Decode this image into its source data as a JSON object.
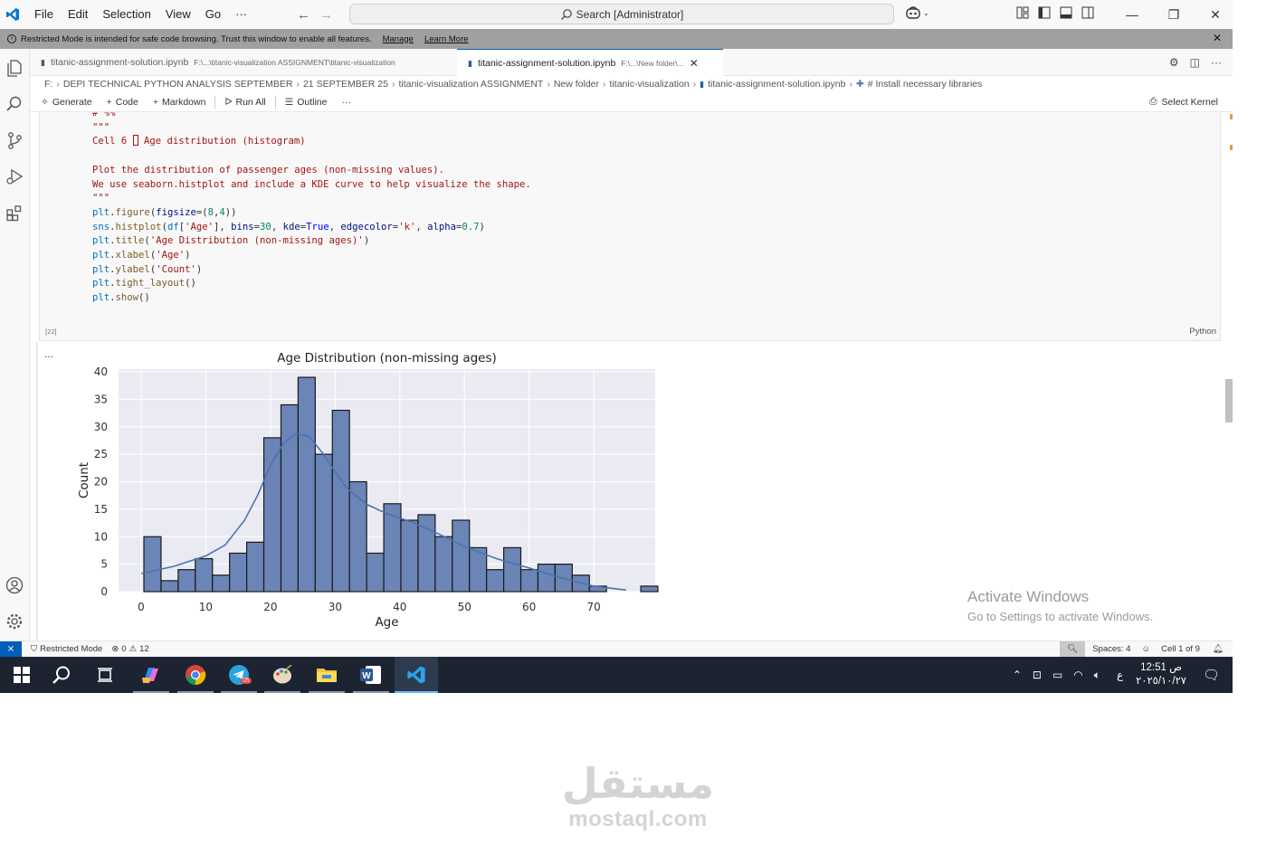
{
  "titlebar": {
    "menu": [
      "File",
      "Edit",
      "Selection",
      "View",
      "Go",
      "···"
    ],
    "search": "Search [Administrator]"
  },
  "banner": {
    "message": "Restricted Mode is intended for safe code browsing. Trust this window to enable all features.",
    "manage": "Manage",
    "learn_more": "Learn More"
  },
  "tabs": [
    {
      "name": "titanic-assignment-solution.ipynb",
      "path": "F:\\...\\titanic-visualization ASSIGNMENT\\titanic-visualization"
    },
    {
      "name": "titanic-assignment-solution.ipynb",
      "path": "F:\\...\\New folder\\..."
    }
  ],
  "breadcrumb": [
    "F:",
    "DEPI TECHNICAL PYTHON ANALYSIS SEPTEMBER",
    "21 SEPTEMBER 25",
    "titanic-visualization ASSIGNMENT",
    "New folder",
    "titanic-visualization",
    "titanic-assignment-solution.ipynb",
    "# Install necessary libraries"
  ],
  "toolbar": {
    "generate": "Generate",
    "code": "Code",
    "markdown": "Markdown",
    "run_all": "Run All",
    "outline": "Outline",
    "more": "···",
    "select_kernel": "Select Kernel"
  },
  "cell": {
    "exec_count": "[22]",
    "language": "Python",
    "output_dots": "...",
    "lines": {
      "l0": "# %%",
      "l1": "\"\"\"",
      "l2a": "Cell 6 ",
      "l2b": " Age distribution (histogram)",
      "l3": "",
      "l4": "Plot the distribution of passenger ages (non-missing values).",
      "l5": "We use seaborn.histplot and include a KDE curve to help visualize the shape.",
      "l6": "\"\"\"",
      "l7": "plt.figure(figsize=(8,4))",
      "l8": "sns.histplot(df['Age'], bins=30, kde=True, edgecolor='k', alpha=0.7)",
      "l9": "plt.title('Age Distribution (non-missing ages)')",
      "l10": "plt.xlabel('Age')",
      "l11": "plt.ylabel('Count')",
      "l12": "plt.tight_layout()",
      "l13": "plt.show()"
    }
  },
  "chart_data": {
    "type": "bar",
    "title": "Age Distribution (non-missing ages)",
    "xlabel": "Age",
    "ylabel": "Count",
    "xlim": [
      -3.5,
      79.5
    ],
    "ylim": [
      0,
      40.5
    ],
    "xticks": [
      0,
      10,
      20,
      30,
      40,
      50,
      60,
      70
    ],
    "yticks": [
      0,
      5,
      10,
      15,
      20,
      25,
      30,
      35,
      40
    ],
    "bin_start": 0.42,
    "bin_width": 2.65,
    "values": [
      10,
      2,
      4,
      6,
      3,
      7,
      9,
      28,
      34,
      39,
      25,
      33,
      20,
      7,
      16,
      13,
      14,
      10,
      13,
      8,
      4,
      8,
      4,
      5,
      5,
      3,
      1,
      0,
      0,
      1
    ],
    "kde": [
      [
        0,
        3.3
      ],
      [
        5,
        4.6
      ],
      [
        10,
        6.5
      ],
      [
        13,
        8.5
      ],
      [
        16,
        13
      ],
      [
        18,
        17.5
      ],
      [
        20,
        23
      ],
      [
        22,
        27
      ],
      [
        24,
        28.8
      ],
      [
        26,
        28.2
      ],
      [
        28,
        25.3
      ],
      [
        30,
        21.8
      ],
      [
        32,
        18.6
      ],
      [
        35,
        15.8
      ],
      [
        38,
        14.2
      ],
      [
        42,
        12.6
      ],
      [
        46,
        10.5
      ],
      [
        50,
        8.2
      ],
      [
        55,
        6.0
      ],
      [
        60,
        4.3
      ],
      [
        65,
        2.5
      ],
      [
        70,
        1.0
      ],
      [
        75,
        0.3
      ]
    ],
    "colors": {
      "bar": "#6a85b6",
      "kde": "#4c72b0",
      "bg": "#eaeaf2",
      "grid": "#ffffff"
    },
    "grid": true
  },
  "watermark_activate": {
    "line1": "Activate Windows",
    "line2": "Go to Settings to activate Windows."
  },
  "statusbar": {
    "restricted": "Restricted Mode",
    "errors": "0",
    "warnings": "12",
    "spaces": "Spaces: 4",
    "cell": "Cell 1 of 9"
  },
  "taskbar": {
    "telegram_badge": "05",
    "lang": "ع",
    "time": "12:51 ص",
    "date": "٢٠٢٥/١٠/٢٧"
  },
  "site_watermark": {
    "arabic": "مستقل",
    "latin": "mostaql.com"
  }
}
